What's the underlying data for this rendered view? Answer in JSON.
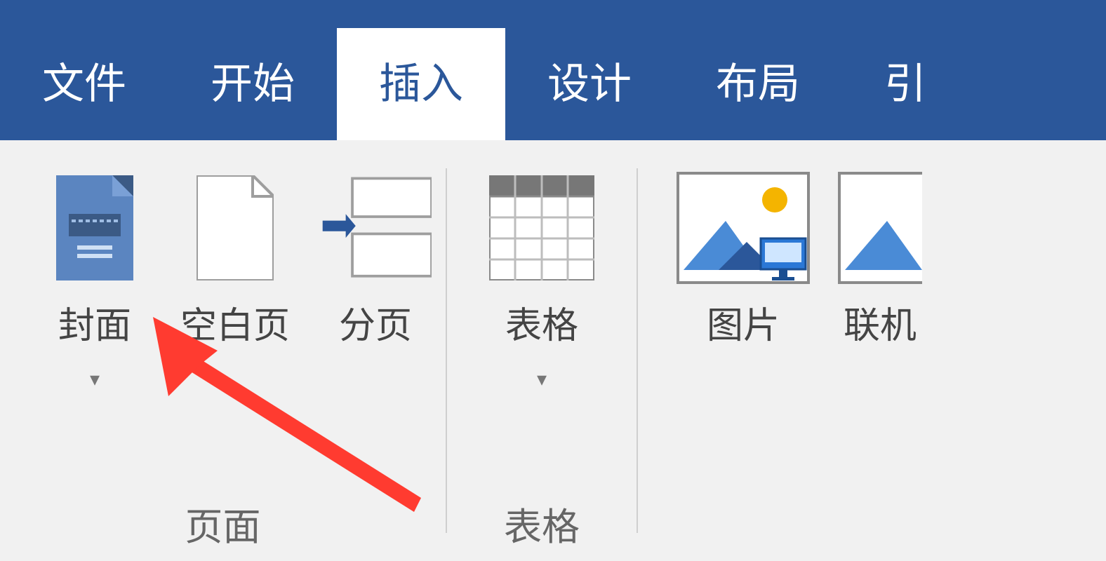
{
  "tabs": {
    "file": "文件",
    "home": "开始",
    "insert": "插入",
    "design": "设计",
    "layout": "布局",
    "references": "引"
  },
  "active_tab": "insert",
  "groups": {
    "pages": {
      "caption": "页面",
      "cover": {
        "label": "封面",
        "has_dropdown": true
      },
      "blank": {
        "label": "空白页"
      },
      "break": {
        "label": "分页"
      }
    },
    "tables": {
      "caption": "表格",
      "table": {
        "label": "表格",
        "has_dropdown": true
      }
    },
    "illustrations": {
      "pictures": {
        "label": "图片"
      },
      "online": {
        "label": "联机"
      }
    }
  },
  "annotation": {
    "type": "arrow",
    "color": "#ff3b30",
    "target": "cover-page-button"
  }
}
